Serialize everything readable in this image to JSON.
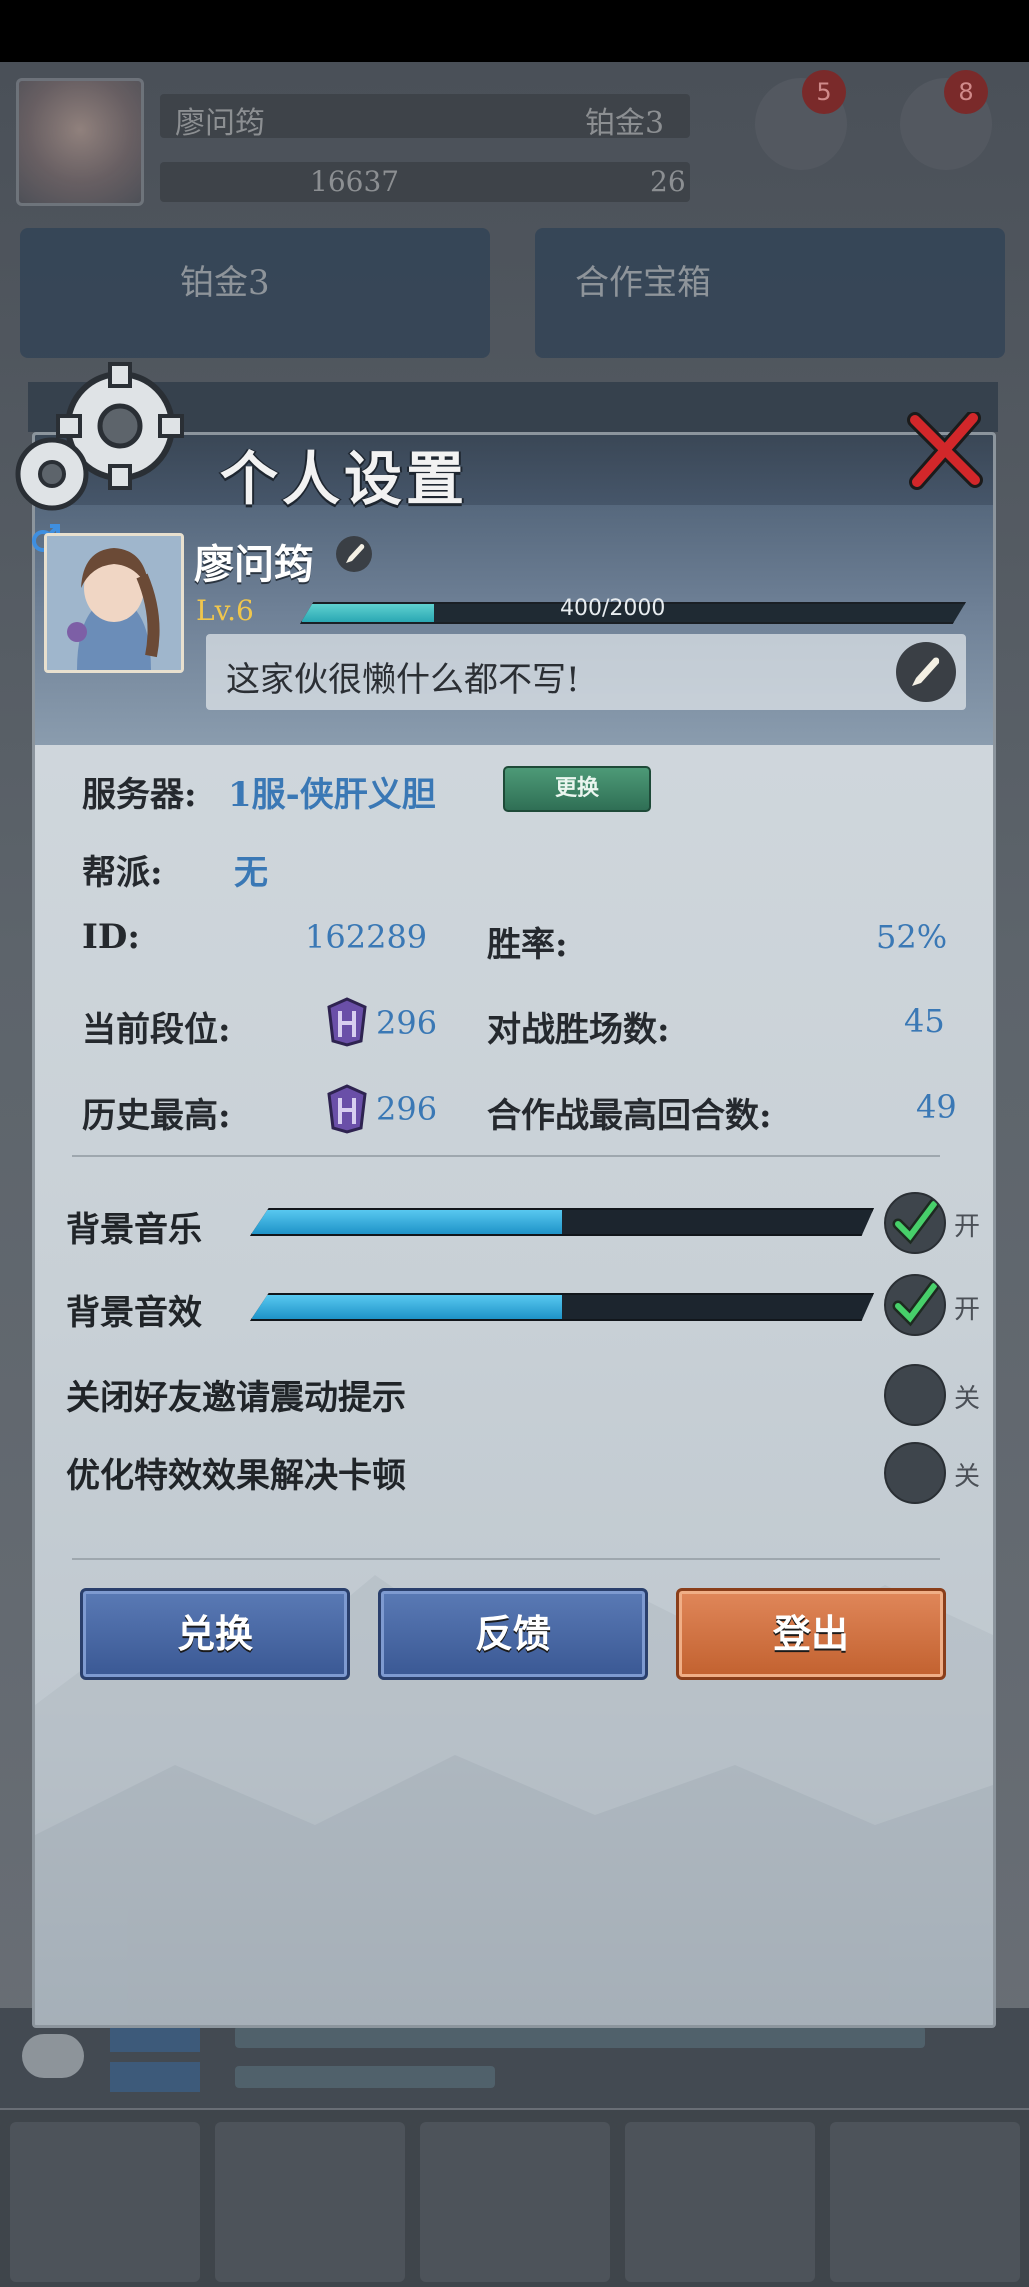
{
  "background": {
    "player_name": "廖问筠",
    "rank_label": "铂金3",
    "coins": "16637",
    "gems": "26",
    "badge_settings": "5",
    "badge_gear": "8",
    "panel_left": "铂金3",
    "panel_right": "合作宝箱"
  },
  "header": {
    "title": "个人设置"
  },
  "profile": {
    "name": "廖问筠",
    "level": "Lv.6",
    "xp_text": "400/2000",
    "xp_fraction": 0.2,
    "signature": "这家伙很懒什么都不写!"
  },
  "info": {
    "server_label": "服务器:",
    "server_value": "1服-侠肝义胆",
    "change_button": "更换",
    "guild_label": "帮派:",
    "guild_value": "无",
    "id_label": "ID:",
    "id_value": "162289",
    "winrate_label": "胜率:",
    "winrate_value": "52%",
    "current_rank_label": "当前段位:",
    "current_rank_value": "296",
    "wins_label": "对战胜场数:",
    "wins_value": "45",
    "best_rank_label": "历史最高:",
    "best_rank_value": "296",
    "coop_label": "合作战最高回合数:",
    "coop_value": "49"
  },
  "settings": {
    "music_label": "背景音乐",
    "music_level": 0.5,
    "music_state": "开",
    "sfx_label": "背景音效",
    "sfx_level": 0.5,
    "sfx_state": "开",
    "vibrate_label": "关闭好友邀请震动提示",
    "vibrate_state": "关",
    "perf_label": "优化特效效果解决卡顿",
    "perf_state": "关"
  },
  "buttons": {
    "redeem": "兑换",
    "feedback": "反馈",
    "logout": "登出"
  },
  "colors": {
    "accent_blue": "#3a78b5",
    "logout_orange": "#c2612f",
    "check_green": "#47d06a"
  }
}
